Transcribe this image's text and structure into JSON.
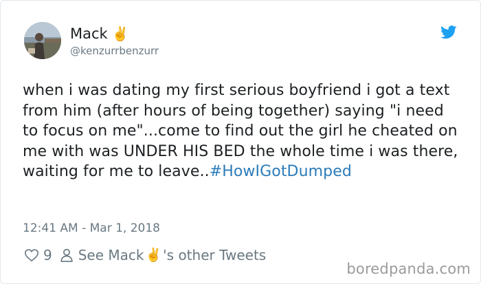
{
  "user": {
    "name": "Mack",
    "emoji": "✌️",
    "handle": "@kenzurrbenzurr"
  },
  "tweet": {
    "text": "when i was dating my first serious boyfriend i got a text from him (after hours of being together) saying \"i need to focus on me\"...come to find out the girl he cheated on me with was UNDER HIS BED the whole time i was there, waiting for me to leave..",
    "hashtag": "#HowIGotDumped",
    "timestamp": "12:41 AM - Mar 1, 2018"
  },
  "actions": {
    "like_count": "9",
    "see_prefix": "See Mack",
    "see_suffix": "'s other Tweets"
  },
  "watermark": "boredpanda.com",
  "colors": {
    "twitter_blue": "#1da1f2",
    "hashtag": "#2b7bb9",
    "text": "#1c2022",
    "muted": "#697882"
  },
  "icons": {
    "brand": "twitter-bird-icon",
    "like": "heart-icon",
    "profile": "person-icon"
  }
}
